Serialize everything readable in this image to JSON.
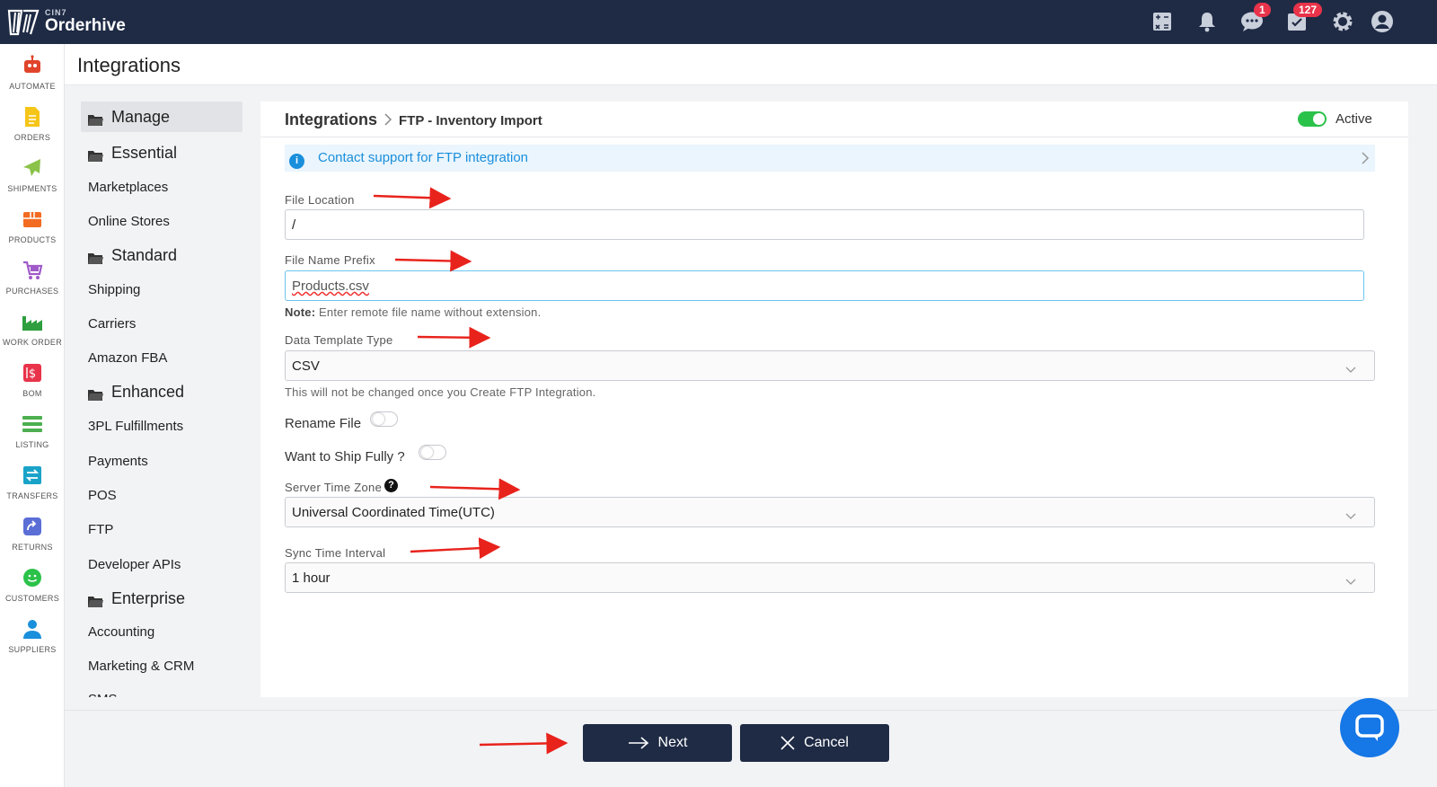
{
  "brand": {
    "small": "CIN7",
    "name": "Orderhive"
  },
  "topbar": {
    "chat_badge": "1",
    "tasks_badge": "127"
  },
  "rail": [
    {
      "label": "AUTOMATE",
      "icon": "robot-icon",
      "color": "#e0452b"
    },
    {
      "label": "ORDERS",
      "icon": "orders-icon",
      "color": "#f5c518"
    },
    {
      "label": "SHIPMENTS",
      "icon": "plane-icon",
      "color": "#8bc34a"
    },
    {
      "label": "PRODUCTS",
      "icon": "box-icon",
      "color": "#f26b21"
    },
    {
      "label": "PURCHASES",
      "icon": "cart-icon",
      "color": "#a05ac8"
    },
    {
      "label": "WORK ORDER",
      "icon": "factory-icon",
      "color": "#2e9e3e"
    },
    {
      "label": "BOM",
      "icon": "bom-icon",
      "color": "#e8334a"
    },
    {
      "label": "LISTING",
      "icon": "listing-icon",
      "color": "#4caf50"
    },
    {
      "label": "TRANSFERS",
      "icon": "transfers-icon",
      "color": "#1aa3c8"
    },
    {
      "label": "RETURNS",
      "icon": "returns-icon",
      "color": "#5b6ed6"
    },
    {
      "label": "CUSTOMERS",
      "icon": "customers-icon",
      "color": "#2bc24a"
    },
    {
      "label": "SUPPLIERS",
      "icon": "suppliers-icon",
      "color": "#1a8fdc"
    }
  ],
  "page_title": "Integrations",
  "submenu": [
    {
      "label": "Manage",
      "group": true,
      "active": true
    },
    {
      "label": "Essential",
      "group": true
    },
    {
      "label": "Marketplaces"
    },
    {
      "label": "Online Stores"
    },
    {
      "label": "Standard",
      "group": true
    },
    {
      "label": "Shipping"
    },
    {
      "label": "Carriers"
    },
    {
      "label": "Amazon FBA"
    },
    {
      "label": "Enhanced",
      "group": true
    },
    {
      "label": "3PL Fulfillments"
    },
    {
      "label": "Payments"
    },
    {
      "label": "POS"
    },
    {
      "label": "FTP"
    },
    {
      "label": "Developer APIs"
    },
    {
      "label": "Enterprise",
      "group": true
    },
    {
      "label": "Accounting"
    },
    {
      "label": "Marketing & CRM"
    },
    {
      "label": "SMS"
    }
  ],
  "panel": {
    "breadcrumb_root": "Integrations",
    "breadcrumb_current": "FTP - Inventory Import",
    "active_label": "Active",
    "info_text": "Contact support for FTP integration",
    "file_location_label": "File Location",
    "file_location_value": "/",
    "file_prefix_label": "File Name Prefix",
    "file_prefix_value": "Products.csv",
    "note_bold": "Note:",
    "note_text": "Enter remote file name without extension.",
    "template_label": "Data Template Type",
    "template_value": "CSV",
    "template_note": "This will not be changed once you Create FTP Integration.",
    "rename_label": "Rename File",
    "ship_label": "Want to Ship Fully ?",
    "timezone_label": "Server Time Zone",
    "timezone_value": "Universal Coordinated Time(UTC)",
    "interval_label": "Sync Time Interval",
    "interval_value": "1 hour"
  },
  "footer": {
    "next_label": "Next",
    "cancel_label": "Cancel"
  },
  "colors": {
    "navy": "#1f2b45",
    "accent_blue": "#1a8fdc",
    "toggle_green": "#2bc24a",
    "badge_red": "#e8334a",
    "annotation_red": "#e8231c"
  }
}
